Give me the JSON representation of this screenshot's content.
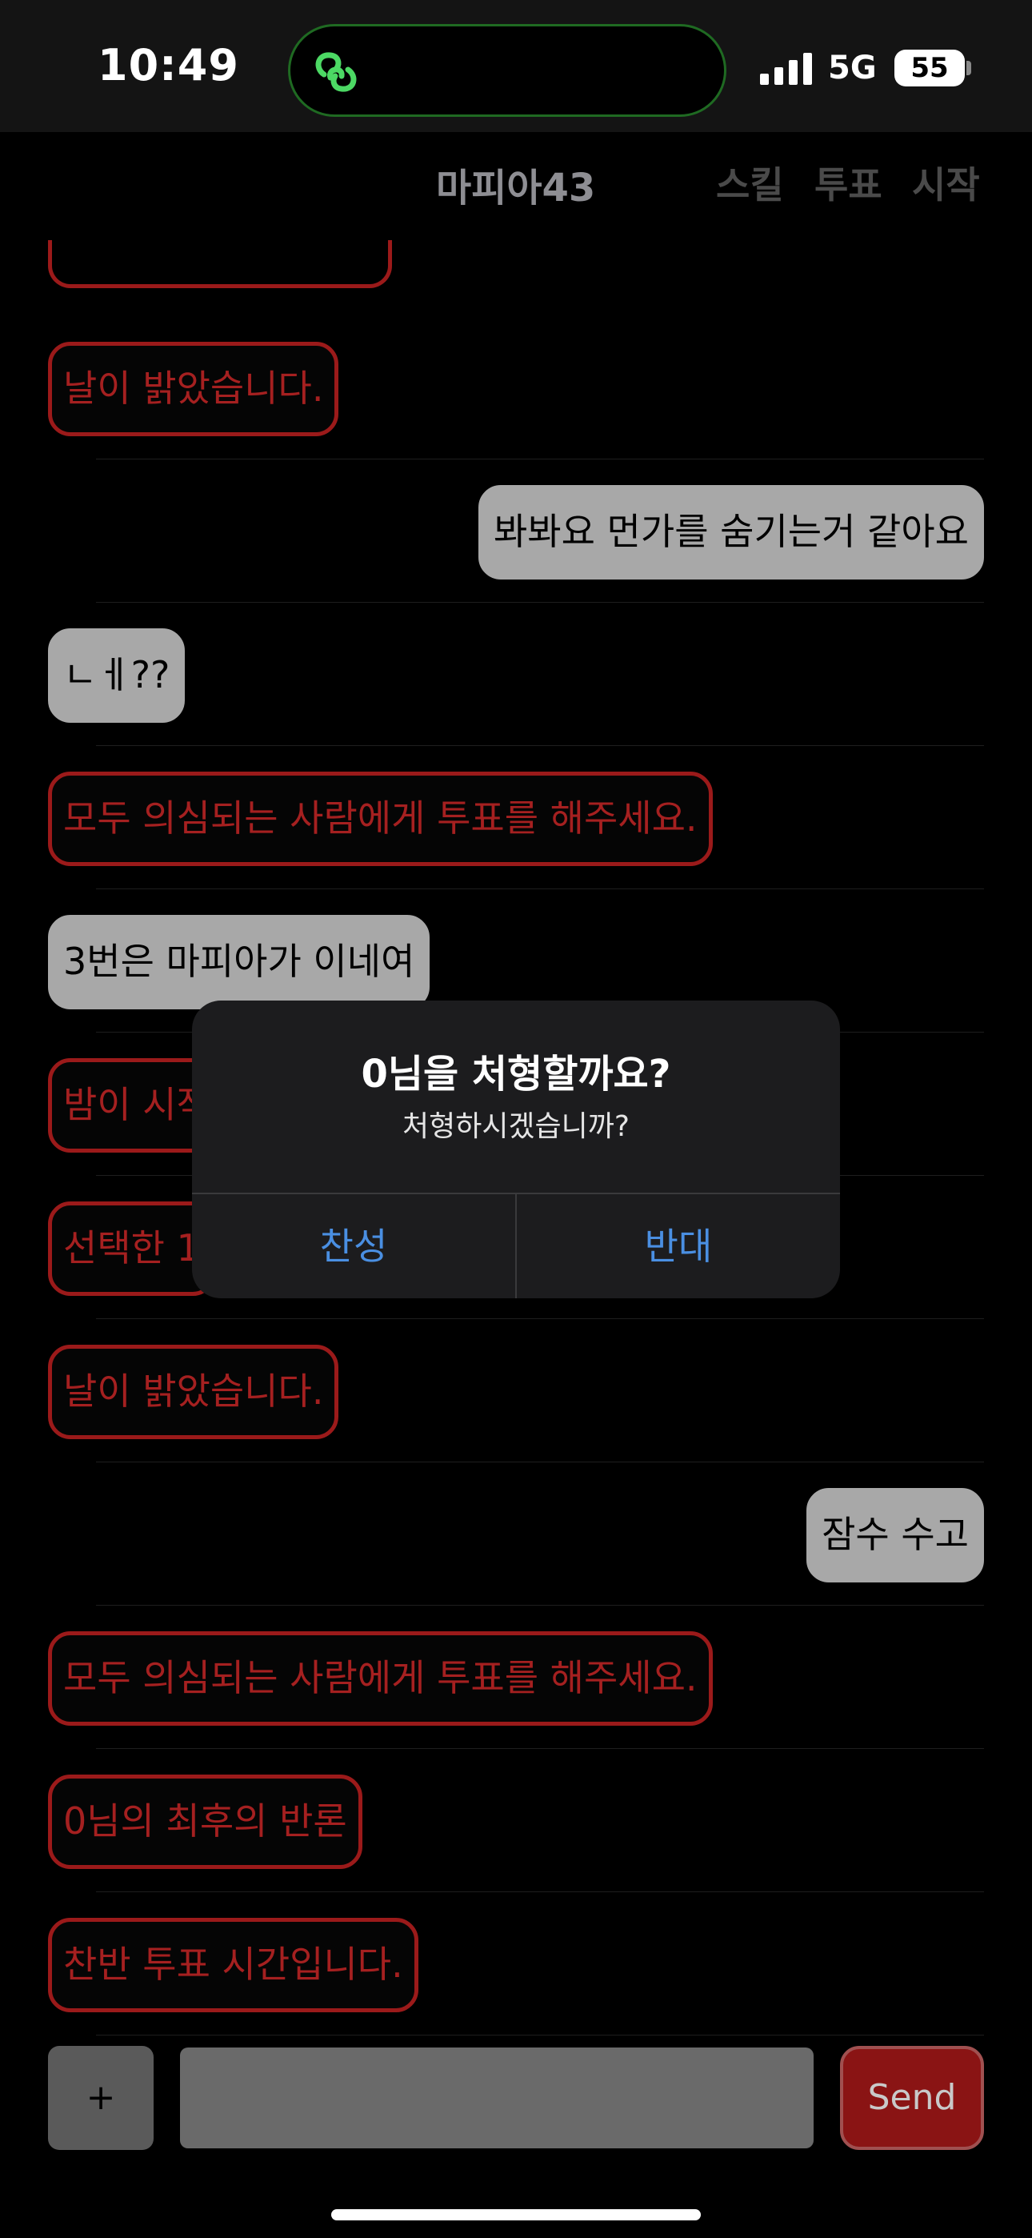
{
  "status_bar": {
    "time": "10:49",
    "network": "5G",
    "battery": "55",
    "island_icon": "link-loop-icon",
    "island_color": "#4cd964"
  },
  "nav": {
    "title": "마피아43",
    "actions": [
      "스킬",
      "투표",
      "시작"
    ]
  },
  "messages": [
    {
      "type": "system",
      "text": "날이 밝았습니다."
    },
    {
      "type": "user-right",
      "text": "봐봐요 먼가를 숨기는거 같아요"
    },
    {
      "type": "user-left",
      "text": "ㄴㅔ??"
    },
    {
      "type": "system",
      "text": "모두 의심되는 사람에게 투표를 해주세요."
    },
    {
      "type": "user-left",
      "text": "3번은 마피아가 이네여"
    },
    {
      "type": "system",
      "text": "밤이 시작"
    },
    {
      "type": "system",
      "text": "선택한 1"
    },
    {
      "type": "system",
      "text": "날이 밝았습니다."
    },
    {
      "type": "user-right",
      "text": "잠수 수고"
    },
    {
      "type": "system",
      "text": "모두 의심되는 사람에게 투표를 해주세요."
    },
    {
      "type": "system",
      "text": "0님의 최후의 반론"
    },
    {
      "type": "system",
      "text": "찬반 투표 시간입니다."
    }
  ],
  "dialog": {
    "title": "0님을 처형할까요?",
    "message": "처형하시겠습니까?",
    "agree": "찬성",
    "disagree": "반대"
  },
  "input_bar": {
    "plus": "+",
    "placeholder": "",
    "send": "Send"
  },
  "colors": {
    "system_border": "#9b1a1a",
    "system_text": "#a52020",
    "user_bubble": "#a8a8a8",
    "dialog_button": "#4a8fe2",
    "send_bg": "#8a1414"
  }
}
